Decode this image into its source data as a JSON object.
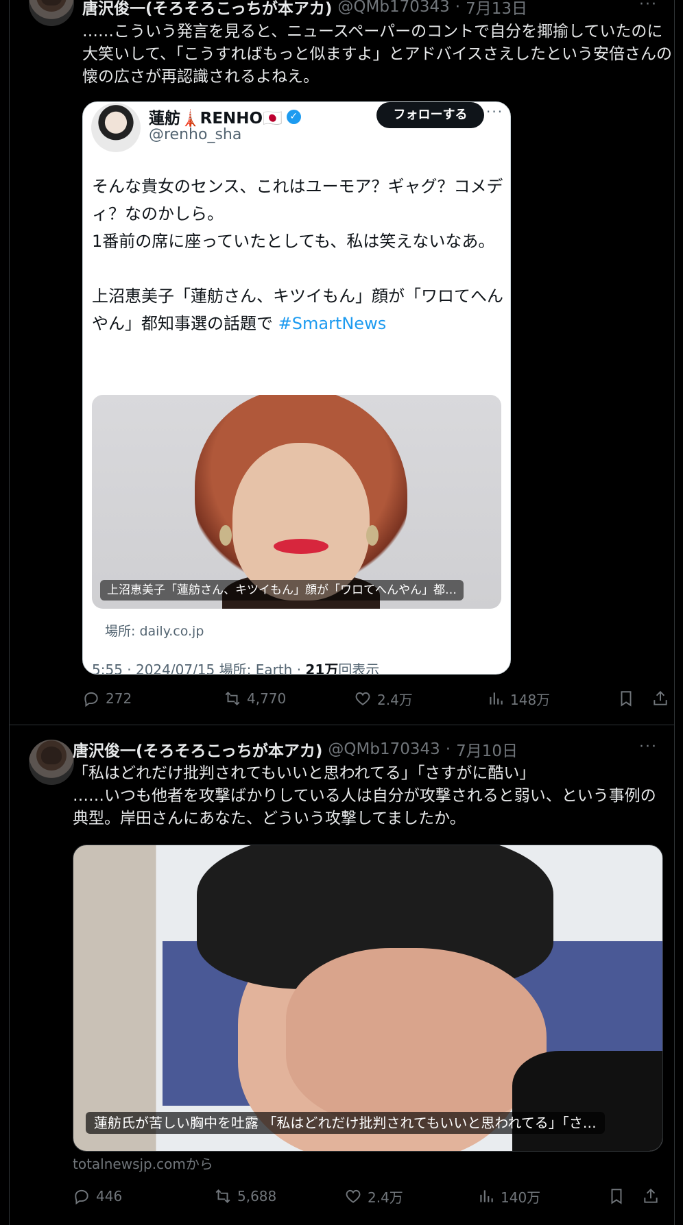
{
  "tweets": [
    {
      "author": "唐沢俊一(そろそろこっちが本アカ)",
      "handle": "@QMb170343",
      "date": "7月13日",
      "more": "···",
      "text": "……こういう発言を見ると、ニュースペーパーのコントで自分を揶揄していたのに大笑いして、「こうすればもっと似ますよ」とアドバイスさえしたという安倍さんの懐の広さが再認識されるよねえ。",
      "quote": {
        "name": "蓮舫🗼RENHO🇯🇵",
        "handle": "@renho_sha",
        "follow_label": "フォローする",
        "more": "···",
        "text_lines": [
          "そんな貴女のセンス、これはユーモア？ギャグ？コメディ？なのかしら。",
          "1番前の席に座っていたとしても、私は笑えないなあ。",
          "",
          "上沼恵美子「蓮舫さん、キツイもん」顔が「ワロてへんやん」都知事選の話題で "
        ],
        "hashtag": "#SmartNews",
        "media_caption": "上沼恵美子「蓮舫さん、キツイもん」顔が「ワロてへんやん」都…",
        "source": "場所: daily.co.jp",
        "meta_time": "5:55 · 2024/07/15 場所: Earth · ",
        "meta_views_num": "21万",
        "meta_views_label": "回表示"
      },
      "stats": {
        "replies": "272",
        "retweets": "4,770",
        "likes": "2.4万",
        "views": "148万"
      }
    },
    {
      "author": "唐沢俊一(そろそろこっちが本アカ)",
      "handle": "@QMb170343",
      "date": "7月10日",
      "more": "···",
      "text_lines": [
        "「私はどれだけ批判されてもいいと思われてる」「さすがに酷い」",
        "……いつも他者を攻撃ばかりしている人は自分が攻撃されると弱い、という事例の典型。岸田さんにあなた、どういう攻撃してましたか。"
      ],
      "media_caption": "蓮舫氏が苦しい胸中を吐露 「私はどれだけ批判されてもいいと思われてる」「さ…",
      "source": "totalnewsjp.comから",
      "stats": {
        "replies": "446",
        "retweets": "5,688",
        "likes": "2.4万",
        "views": "140万"
      }
    }
  ],
  "colors": {
    "background": "#000000",
    "text": "#e7e9ea",
    "muted": "#71767b",
    "link": "#1d9bf0",
    "divider": "#2f3336"
  },
  "icons": [
    "reply-icon",
    "retweet-icon",
    "like-icon",
    "views-icon",
    "bookmark-icon",
    "share-icon",
    "verified-icon",
    "more-icon"
  ]
}
